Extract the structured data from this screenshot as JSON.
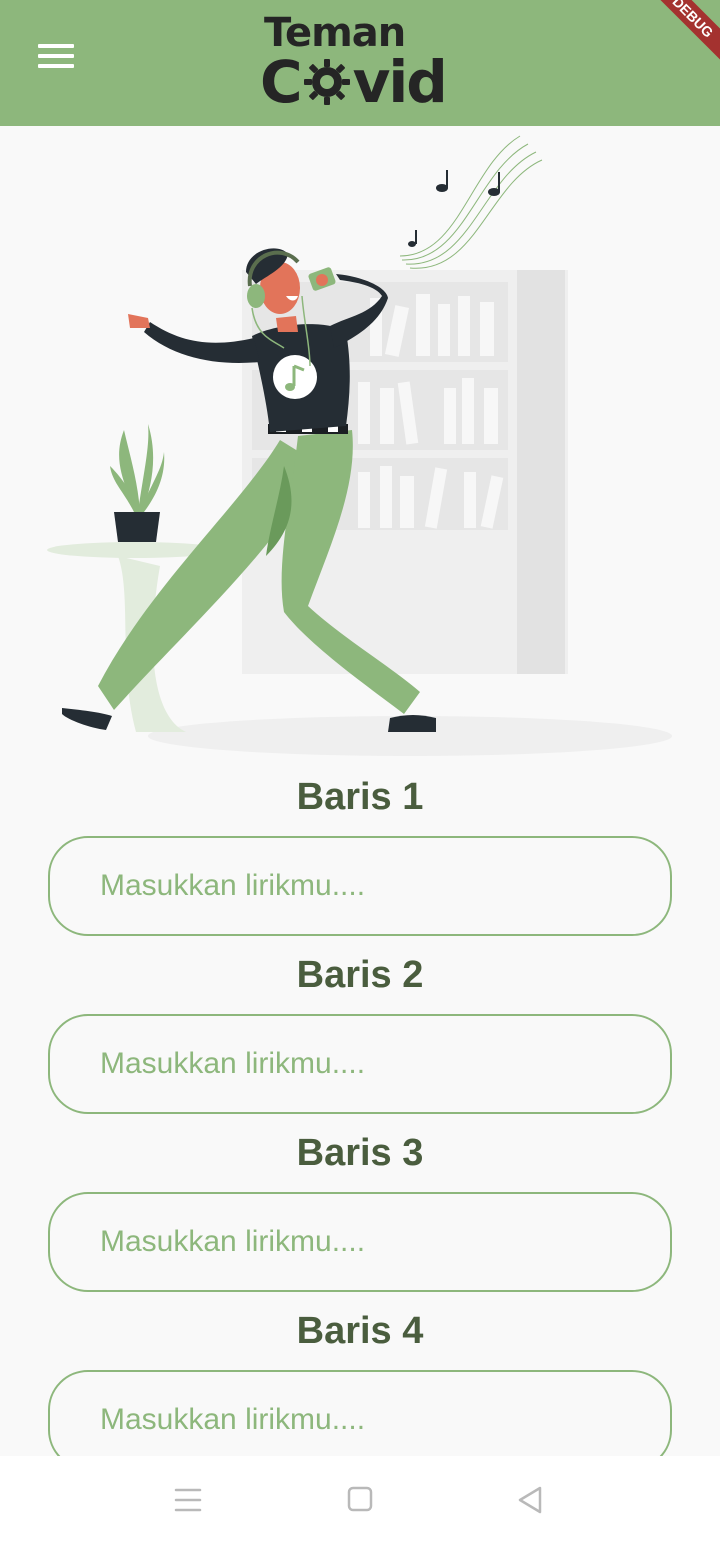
{
  "appbar": {
    "logo_top": "Teman",
    "logo_bottom_left": "C",
    "logo_bottom_right": "vid",
    "debug_label": "DEBUG",
    "background": "#8db77c"
  },
  "icons": {
    "menu": "hamburger-menu-icon",
    "logo_gear": "virus-gear-icon",
    "nav_recents": "recents-icon",
    "nav_home": "home-icon",
    "nav_back": "back-icon"
  },
  "illustration": {
    "subject": "person-singing-with-headphones"
  },
  "form": {
    "rows": [
      {
        "label": "Baris 1",
        "placeholder": "Masukkan lirikmu...."
      },
      {
        "label": "Baris 2",
        "placeholder": "Masukkan lirikmu...."
      },
      {
        "label": "Baris 3",
        "placeholder": "Masukkan lirikmu...."
      },
      {
        "label": "Baris 4",
        "placeholder": "Masukkan lirikmu...."
      }
    ]
  },
  "colors": {
    "accent": "#8db77c",
    "label_text": "#4a5d3e",
    "background": "#f9f9f9"
  }
}
